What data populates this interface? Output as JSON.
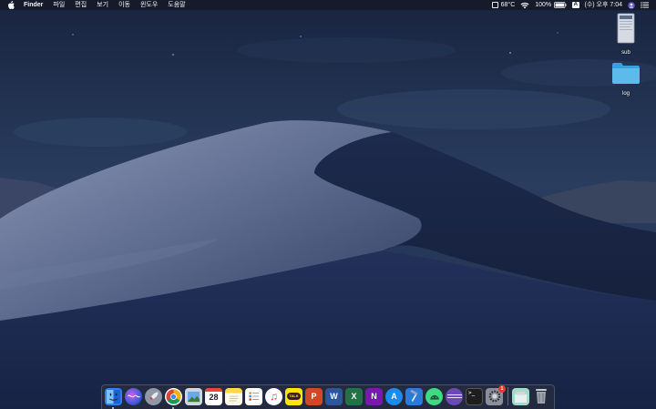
{
  "menubar": {
    "app_name": "Finder",
    "menus": [
      "파일",
      "편집",
      "보기",
      "이동",
      "윈도우",
      "도움말"
    ],
    "status": {
      "temperature": "68°C",
      "battery": "100%",
      "input_source": "A",
      "datetime": "(수) 오후 7:04"
    }
  },
  "desktop_icons": [
    {
      "label": "sub",
      "icon": "document-icon"
    },
    {
      "label": "log",
      "icon": "folder-icon"
    }
  ],
  "dock": {
    "apps": [
      {
        "name": "finder",
        "letter": "",
        "color": "#2e7ff0",
        "running": true
      },
      {
        "name": "siri",
        "letter": "",
        "color": "#7a3fd8"
      },
      {
        "name": "launchpad",
        "letter": "",
        "color": "#8f98a6"
      },
      {
        "name": "chrome",
        "letter": "",
        "color": "#ffffff",
        "running": true
      },
      {
        "name": "preview",
        "letter": "",
        "color": "#6aa8e8"
      },
      {
        "name": "calendar",
        "letter": "28",
        "color": "#ffffff"
      },
      {
        "name": "notes",
        "letter": "",
        "color": "#ffd94a"
      },
      {
        "name": "reminders",
        "letter": "",
        "color": "#ffffff"
      },
      {
        "name": "itunes",
        "letter": "♫",
        "color": "#ffffff"
      },
      {
        "name": "kakaotalk",
        "letter": "TALK",
        "color": "#ffe600"
      },
      {
        "name": "powerpoint",
        "letter": "P",
        "color": "#d24726"
      },
      {
        "name": "word",
        "letter": "W",
        "color": "#2b579a"
      },
      {
        "name": "excel",
        "letter": "X",
        "color": "#217346"
      },
      {
        "name": "onenote",
        "letter": "N",
        "color": "#7719aa"
      },
      {
        "name": "app-store",
        "letter": "A",
        "color": "#1a8cf0"
      },
      {
        "name": "xcode",
        "letter": "",
        "color": "#2b7bd8"
      },
      {
        "name": "android-studio",
        "letter": "",
        "color": "#3ddc84"
      },
      {
        "name": "visual-studio",
        "letter": "",
        "color": "#6c4ab6"
      },
      {
        "name": "terminal",
        "letter": ">_",
        "color": "#1e1e1e"
      },
      {
        "name": "system-preferences",
        "letter": "",
        "color": "#8a8f98",
        "badge": "1"
      }
    ],
    "right": [
      {
        "name": "downloads",
        "color": "#a7d8c9"
      },
      {
        "name": "trash",
        "color": "#c8ccd2"
      }
    ]
  }
}
